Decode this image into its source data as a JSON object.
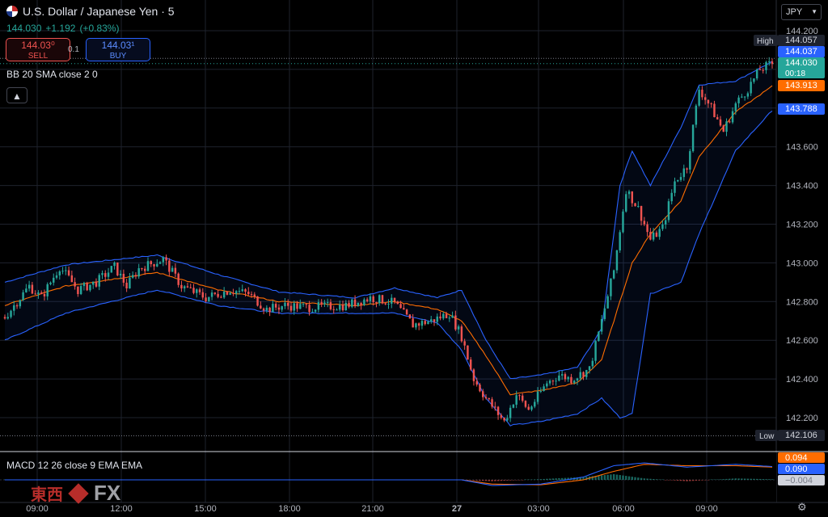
{
  "header": {
    "title": "U.S. Dollar / Japanese Yen · 5",
    "last": "144.030",
    "change": "+1.192",
    "change_pct": "(+0.83%)"
  },
  "trade": {
    "sell_price": "144.03⁰",
    "sell_label": "SELL",
    "spread": "0.1",
    "buy_price": "144.03¹",
    "buy_label": "BUY"
  },
  "currency": "JPY",
  "indicators": {
    "bb_label": "BB 20 SMA close 2 0",
    "macd_label": "MACD 12 26 close 9 EMA EMA"
  },
  "watermark": {
    "cn": "東西",
    "fx": "FX"
  },
  "colors": {
    "up": "#26a69a",
    "down": "#ef5350",
    "band": "#2962ff",
    "basis": "#ff6d00",
    "grid": "#1e222d"
  },
  "chart_data": {
    "type": "candlestick",
    "title": "U.S. Dollar / Japanese Yen · 5",
    "y_axis": {
      "ticks": [
        "144.200",
        "144.000",
        "143.800",
        "143.600",
        "143.400",
        "143.200",
        "143.000",
        "142.800",
        "142.600",
        "142.400",
        "142.200"
      ],
      "range": [
        142.05,
        144.3
      ]
    },
    "x_axis": {
      "ticks": [
        "09:00",
        "12:00",
        "15:00",
        "18:00",
        "21:00",
        "27",
        "03:00",
        "06:00",
        "09:00"
      ]
    },
    "high_label": "High",
    "high_value": "144.057",
    "low_label": "Low",
    "low_value": "142.106",
    "price_tags": [
      {
        "value": "144.037",
        "color": "#2962ff"
      },
      {
        "value": "144.030",
        "color": "#26a69a",
        "sub": "00:18"
      },
      {
        "value": "143.913",
        "color": "#ff6d00"
      },
      {
        "value": "143.788",
        "color": "#2962ff"
      }
    ],
    "macd_tags": [
      {
        "value": "0.094",
        "color": "#ff6d00"
      },
      {
        "value": "0.090",
        "color": "#2962ff"
      },
      {
        "value": "−0.004",
        "color": "#b2b5be"
      }
    ],
    "close_anchors": [
      [
        0,
        142.72
      ],
      [
        8,
        142.88
      ],
      [
        12,
        142.82
      ],
      [
        18,
        142.98
      ],
      [
        24,
        142.86
      ],
      [
        30,
        142.9
      ],
      [
        36,
        142.98
      ],
      [
        40,
        142.88
      ],
      [
        44,
        142.97
      ],
      [
        52,
        143.02
      ],
      [
        58,
        142.88
      ],
      [
        66,
        142.82
      ],
      [
        74,
        142.86
      ],
      [
        80,
        142.84
      ],
      [
        86,
        142.76
      ],
      [
        92,
        142.78
      ],
      [
        100,
        142.77
      ],
      [
        112,
        142.78
      ],
      [
        120,
        142.82
      ],
      [
        126,
        142.8
      ],
      [
        128,
        142.79
      ],
      [
        134,
        142.68
      ],
      [
        140,
        142.7
      ],
      [
        146,
        142.74
      ],
      [
        150,
        142.62
      ],
      [
        154,
        142.4
      ],
      [
        158,
        142.3
      ],
      [
        164,
        142.18
      ],
      [
        168,
        142.32
      ],
      [
        172,
        142.24
      ],
      [
        178,
        142.38
      ],
      [
        182,
        142.42
      ],
      [
        186,
        142.4
      ],
      [
        192,
        142.45
      ],
      [
        196,
        142.7
      ],
      [
        200,
        142.96
      ],
      [
        204,
        143.38
      ],
      [
        208,
        143.28
      ],
      [
        212,
        143.12
      ],
      [
        216,
        143.18
      ],
      [
        220,
        143.42
      ],
      [
        224,
        143.5
      ],
      [
        228,
        143.9
      ],
      [
        232,
        143.8
      ],
      [
        236,
        143.68
      ],
      [
        240,
        143.82
      ],
      [
        244,
        143.9
      ],
      [
        248,
        144.0
      ],
      [
        252,
        144.03
      ]
    ],
    "bollinger": {
      "upper": [
        [
          0,
          142.9
        ],
        [
          20,
          142.99
        ],
        [
          50,
          143.04
        ],
        [
          70,
          142.94
        ],
        [
          90,
          142.85
        ],
        [
          115,
          142.82
        ],
        [
          128,
          142.87
        ],
        [
          142,
          142.82
        ],
        [
          150,
          142.86
        ],
        [
          158,
          142.6
        ],
        [
          166,
          142.4
        ],
        [
          176,
          142.42
        ],
        [
          188,
          142.46
        ],
        [
          196,
          142.66
        ],
        [
          202,
          143.4
        ],
        [
          206,
          143.58
        ],
        [
          212,
          143.4
        ],
        [
          222,
          143.7
        ],
        [
          228,
          143.92
        ],
        [
          240,
          143.94
        ],
        [
          252,
          144.04
        ]
      ],
      "basis": [
        [
          0,
          142.78
        ],
        [
          20,
          142.88
        ],
        [
          50,
          142.95
        ],
        [
          70,
          142.86
        ],
        [
          90,
          142.8
        ],
        [
          115,
          142.78
        ],
        [
          128,
          142.8
        ],
        [
          142,
          142.76
        ],
        [
          150,
          142.7
        ],
        [
          158,
          142.52
        ],
        [
          166,
          142.32
        ],
        [
          176,
          142.34
        ],
        [
          188,
          142.38
        ],
        [
          196,
          142.5
        ],
        [
          202,
          142.8
        ],
        [
          206,
          143.0
        ],
        [
          212,
          143.15
        ],
        [
          222,
          143.32
        ],
        [
          228,
          143.55
        ],
        [
          240,
          143.78
        ],
        [
          252,
          143.913
        ]
      ],
      "lower": [
        [
          0,
          142.6
        ],
        [
          20,
          142.74
        ],
        [
          50,
          142.86
        ],
        [
          70,
          142.78
        ],
        [
          90,
          142.74
        ],
        [
          115,
          142.74
        ],
        [
          128,
          142.74
        ],
        [
          142,
          142.69
        ],
        [
          150,
          142.55
        ],
        [
          158,
          142.3
        ],
        [
          166,
          142.16
        ],
        [
          176,
          142.18
        ],
        [
          188,
          142.22
        ],
        [
          196,
          142.3
        ],
        [
          202,
          142.2
        ],
        [
          206,
          142.22
        ],
        [
          212,
          142.84
        ],
        [
          222,
          142.9
        ],
        [
          228,
          143.15
        ],
        [
          240,
          143.58
        ],
        [
          252,
          143.788
        ]
      ]
    },
    "macd": {
      "macd": [
        [
          0,
          0
        ],
        [
          150,
          0
        ],
        [
          160,
          -0.04
        ],
        [
          176,
          -0.03
        ],
        [
          190,
          0.02
        ],
        [
          200,
          0.1
        ],
        [
          210,
          0.12
        ],
        [
          224,
          0.09
        ],
        [
          240,
          0.11
        ],
        [
          252,
          0.094
        ]
      ],
      "signal": [
        [
          0,
          0
        ],
        [
          150,
          0
        ],
        [
          160,
          -0.03
        ],
        [
          176,
          -0.035
        ],
        [
          190,
          0.0
        ],
        [
          200,
          0.06
        ],
        [
          210,
          0.11
        ],
        [
          224,
          0.1
        ],
        [
          240,
          0.1
        ],
        [
          252,
          0.09
        ]
      ]
    }
  }
}
